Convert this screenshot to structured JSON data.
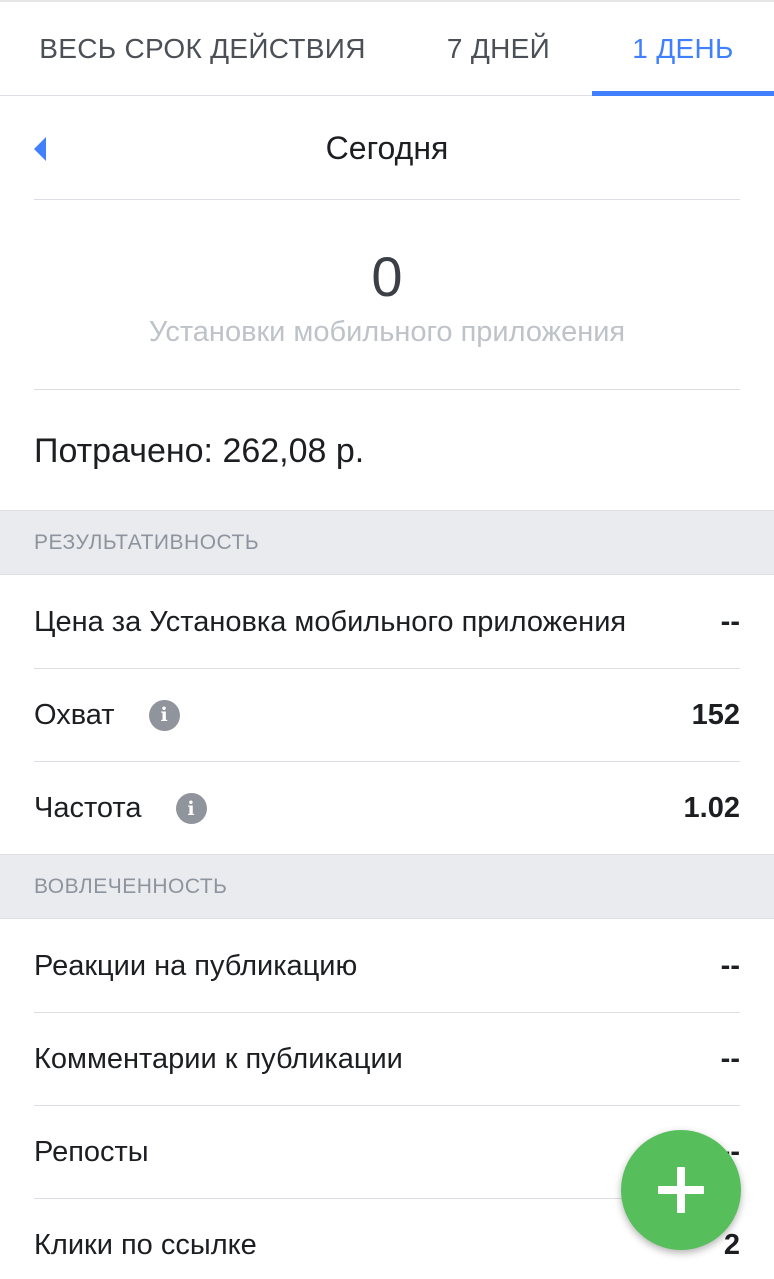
{
  "tabs": [
    {
      "label": "ВЕСЬ СРОК ДЕЙСТВИЯ",
      "active": false
    },
    {
      "label": "7 ДНЕЙ",
      "active": false
    },
    {
      "label": "1 ДЕНЬ",
      "active": true
    }
  ],
  "date_nav": {
    "label": "Сегодня",
    "back_icon": "chevron-left-icon"
  },
  "metric": {
    "value": "0",
    "label": "Установки мобильного приложения"
  },
  "spent": "Потрачено: 262,08 р.",
  "sections": [
    {
      "title": "РЕЗУЛЬТАТИВНОСТЬ",
      "rows": [
        {
          "label": "Цена за Установка мобильного приложения",
          "value": "--",
          "info": false
        },
        {
          "label": "Охват",
          "value": "152",
          "info": true
        },
        {
          "label": "Частота",
          "value": "1.02",
          "info": true
        }
      ]
    },
    {
      "title": "ВОВЛЕЧЕННОСТЬ",
      "rows": [
        {
          "label": "Реакции на публикацию",
          "value": "--"
        },
        {
          "label": "Комментарии к публикации",
          "value": "--"
        },
        {
          "label": "Репосты",
          "value": "--"
        },
        {
          "label": "Клики по ссылке",
          "value": "2"
        }
      ]
    }
  ],
  "info_icon_glyph": "i",
  "fab": {
    "icon": "plus-icon"
  },
  "colors": {
    "accent": "#4080ff",
    "fab": "#56bf5b",
    "section_bg": "#e9ebee",
    "muted_text": "#bec3c9"
  }
}
